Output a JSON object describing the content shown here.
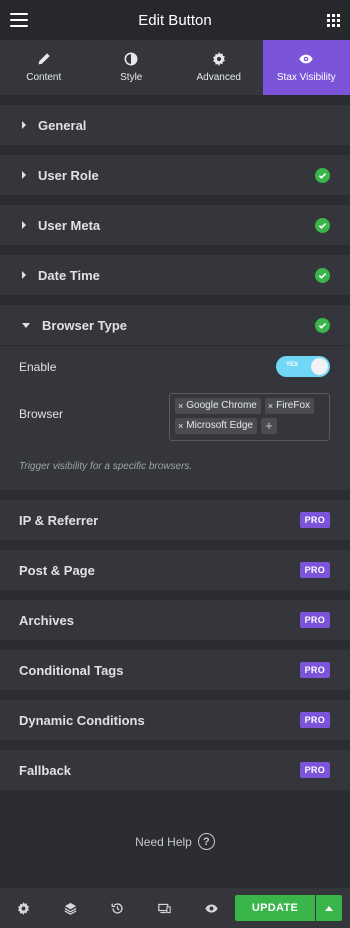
{
  "header": {
    "title": "Edit Button"
  },
  "tabs": [
    {
      "label": "Content",
      "icon": "pencil-icon"
    },
    {
      "label": "Style",
      "icon": "half-circle-icon"
    },
    {
      "label": "Advanced",
      "icon": "gear-icon"
    },
    {
      "label": "Stax Visibility",
      "icon": "eye-icon",
      "active": true
    }
  ],
  "sections": {
    "general": {
      "label": "General"
    },
    "user_role": {
      "label": "User Role"
    },
    "user_meta": {
      "label": "User Meta"
    },
    "date_time": {
      "label": "Date Time"
    },
    "browser_type": {
      "label": "Browser Type"
    },
    "ip_referrer": {
      "label": "IP & Referrer"
    },
    "post_page": {
      "label": "Post & Page"
    },
    "archives": {
      "label": "Archives"
    },
    "conditional_tags": {
      "label": "Conditional Tags"
    },
    "dynamic_conditions": {
      "label": "Dynamic Conditions"
    },
    "fallback": {
      "label": "Fallback"
    }
  },
  "pro_badge": "PRO",
  "browser_type": {
    "enable_label": "Enable",
    "toggle_text": "YES",
    "browser_label": "Browser",
    "tags": [
      "Google Chrome",
      "FireFox",
      "Microsoft Edge"
    ],
    "tag_remove": "×",
    "tag_add": "+",
    "hint": "Trigger visibility for a specific browsers."
  },
  "help": {
    "label": "Need Help",
    "icon_text": "?"
  },
  "footer": {
    "icons": [
      "gear-icon",
      "layers-icon",
      "history-icon",
      "responsive-icon",
      "eye-icon"
    ],
    "update_label": "UPDATE"
  },
  "colors": {
    "accent": "#7c54d9",
    "success": "#39b54a",
    "toggle": "#71d7f7"
  }
}
